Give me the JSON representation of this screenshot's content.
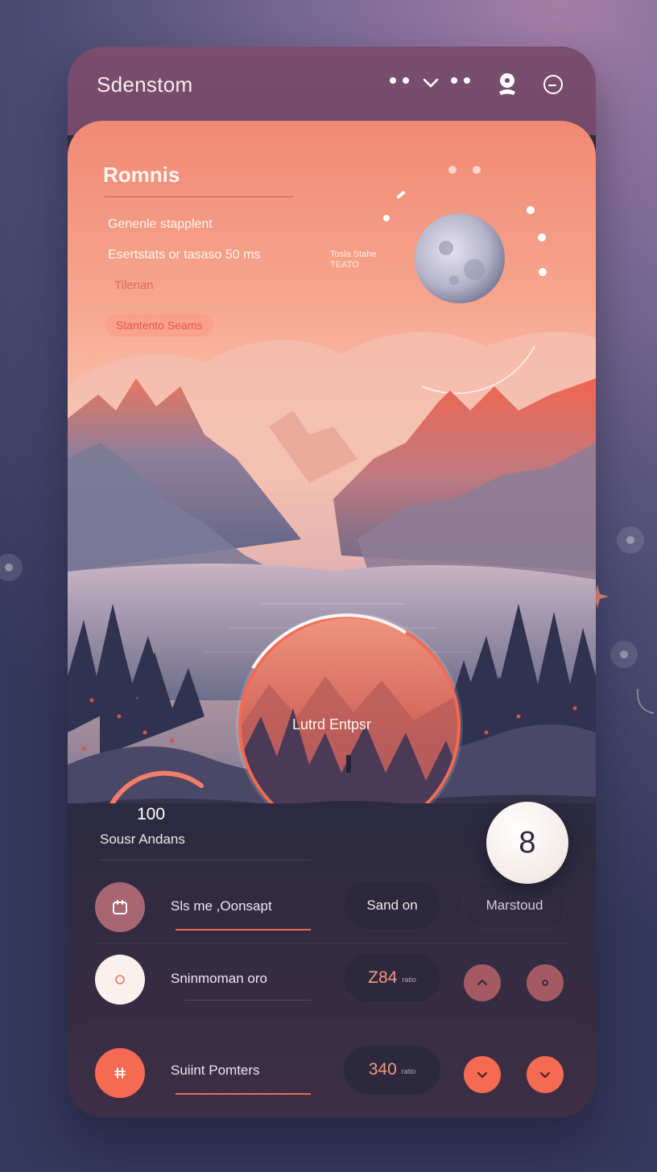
{
  "topbar": {
    "title": "Sdenstom",
    "icons": [
      "more-dots-icon",
      "chevron-down-icon",
      "more-dots-icon",
      "user-icon",
      "clock-icon"
    ]
  },
  "hero": {
    "title": "Romnis",
    "line1": "Genenle stapplent",
    "line2": "Esertstats or tasaso 50 ms",
    "line3": "Tilenan",
    "chip": "Stantento Seams",
    "moon_label_1": "Tosla Stahe",
    "moon_label_2": "TEATO",
    "circle_label": "Lutrd Entpsr"
  },
  "stats": {
    "value": "100",
    "label": "Sousr Andans",
    "badge": "8"
  },
  "rows": [
    {
      "label": "Sls me ,Oonsapt",
      "pill_text": "Sand on",
      "ghost": "Marstoud",
      "icon": "calendar-icon"
    },
    {
      "label": "Sninmoman oro",
      "pill_value": "Z84",
      "pill_unit": "ratio",
      "icon": "circle-icon"
    },
    {
      "label": "Suiint Pomters",
      "pill_value": "340",
      "pill_unit": "ratio",
      "icon": "currency-icon"
    }
  ],
  "colors": {
    "accent": "#f46a52",
    "topbar": "#7a4d6f",
    "card_bottom": "#2e2a40",
    "mauve_button": "#a66672"
  }
}
